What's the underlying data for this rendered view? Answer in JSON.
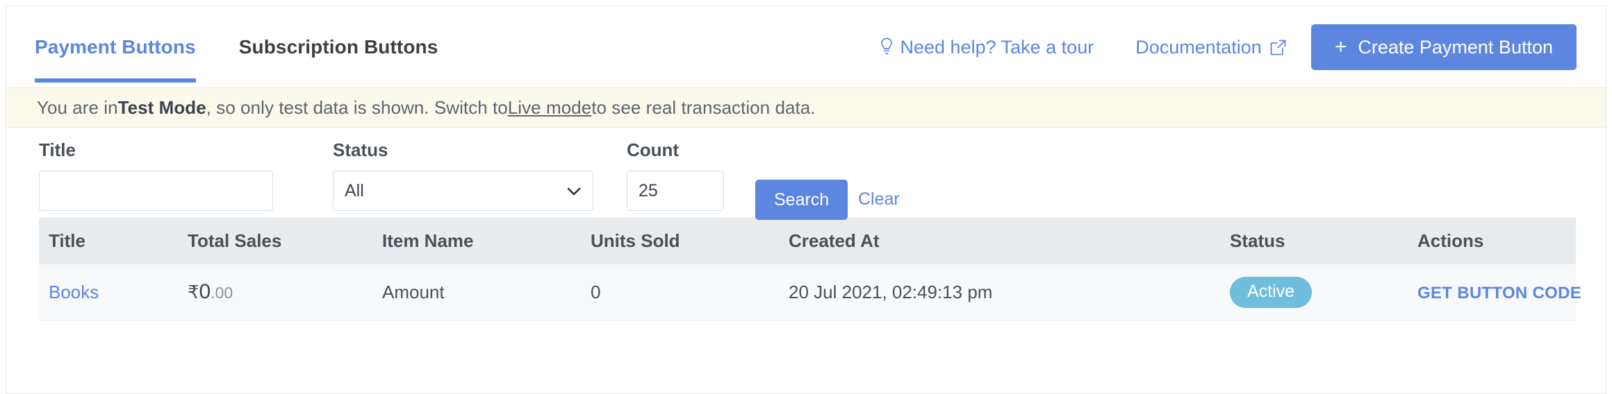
{
  "tabs": [
    {
      "label": "Payment Buttons",
      "active": true
    },
    {
      "label": "Subscription Buttons",
      "active": false
    }
  ],
  "header": {
    "help_link": "Need help? Take a tour",
    "help_icon": "lightbulb-icon",
    "documentation_link": "Documentation",
    "documentation_icon": "external-link-icon",
    "create_button": "Create Payment Button",
    "create_button_icon": "plus-icon",
    "accent_color": "#5c86e0"
  },
  "banner": {
    "prefix": "You are in ",
    "mode_bold": "Test Mode",
    "middle": ", so only test data is shown. Switch to ",
    "link": "Live mode",
    "suffix": " to see real transaction data.",
    "background_color": "#fcfaec"
  },
  "filters": {
    "title": {
      "label": "Title",
      "value": "",
      "placeholder": ""
    },
    "status": {
      "label": "Status",
      "value": "All",
      "options": [
        "All"
      ]
    },
    "count": {
      "label": "Count",
      "value": "25"
    },
    "search_button": "Search",
    "clear_link": "Clear"
  },
  "table": {
    "columns": [
      "Title",
      "Total Sales",
      "Item Name",
      "Units Sold",
      "Created At",
      "Status",
      "Actions"
    ],
    "rows": [
      {
        "title": "Books",
        "total_sales_currency": "₹",
        "total_sales_whole": "0",
        "total_sales_cents": ".00",
        "item_name": "Amount",
        "units_sold": "0",
        "created_at": "20 Jul 2021, 02:49:13 pm",
        "status": "Active",
        "status_color": "#6fbedd",
        "action": "GET BUTTON CODE"
      }
    ]
  }
}
